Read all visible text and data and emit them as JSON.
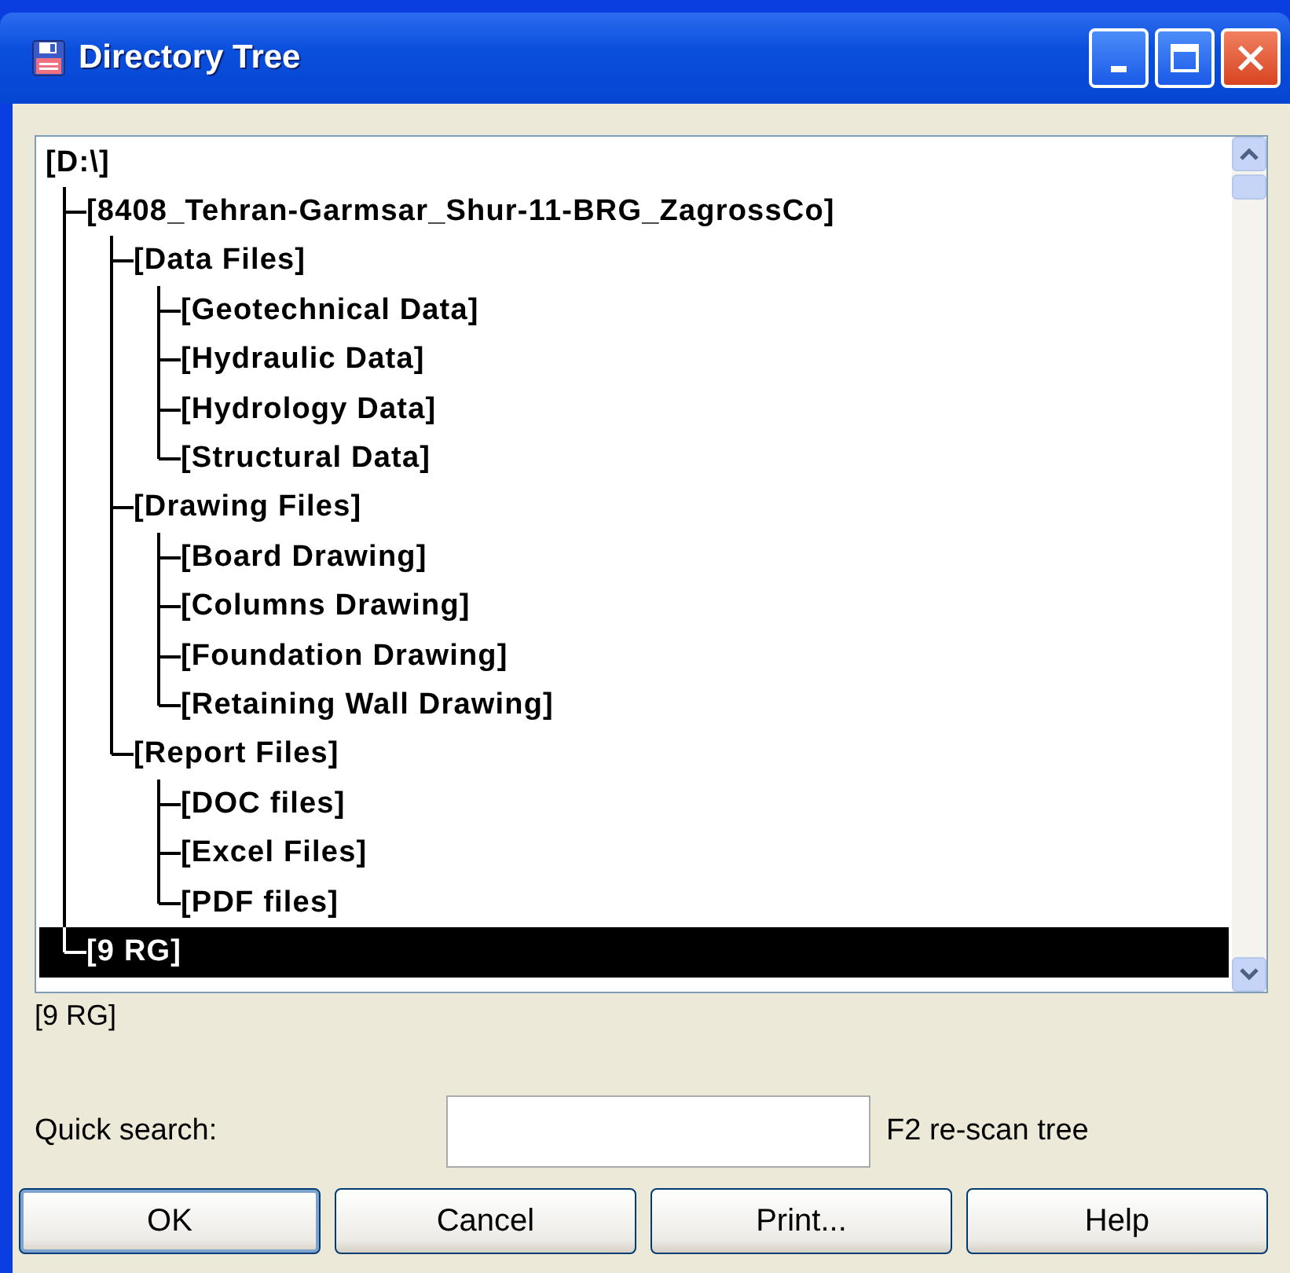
{
  "window": {
    "title": "Directory Tree"
  },
  "tree": [
    {
      "label": "[D:\\]",
      "selected": false,
      "children": [
        {
          "label": "[8408_Tehran-Garmsar_Shur-11-BRG_ZagrossCo]",
          "selected": false,
          "children": [
            {
              "label": "[Data Files]",
              "selected": false,
              "children": [
                {
                  "label": "[Geotechnical Data]",
                  "selected": false
                },
                {
                  "label": "[Hydraulic Data]",
                  "selected": false
                },
                {
                  "label": "[Hydrology Data]",
                  "selected": false
                },
                {
                  "label": "[Structural Data]",
                  "selected": false
                }
              ]
            },
            {
              "label": "[Drawing Files]",
              "selected": false,
              "children": [
                {
                  "label": "[Board Drawing]",
                  "selected": false
                },
                {
                  "label": "[Columns Drawing]",
                  "selected": false
                },
                {
                  "label": "[Foundation Drawing]",
                  "selected": false
                },
                {
                  "label": "[Retaining Wall Drawing]",
                  "selected": false
                }
              ]
            },
            {
              "label": "[Report Files]",
              "selected": false,
              "children": [
                {
                  "label": "[DOC files]",
                  "selected": false
                },
                {
                  "label": "[Excel Files]",
                  "selected": false
                },
                {
                  "label": "[PDF files]",
                  "selected": false
                }
              ]
            }
          ]
        },
        {
          "label": "[9 RG]",
          "selected": true
        }
      ]
    }
  ],
  "selected_path": "[9 RG]",
  "quick_search": {
    "label": "Quick search:"
  },
  "rescan_hint": "F2 re-scan tree",
  "buttons": [
    {
      "label": "OK",
      "default": true
    },
    {
      "label": "Cancel",
      "default": false
    },
    {
      "label": "Print...",
      "default": false
    },
    {
      "label": "Help",
      "default": false
    }
  ]
}
